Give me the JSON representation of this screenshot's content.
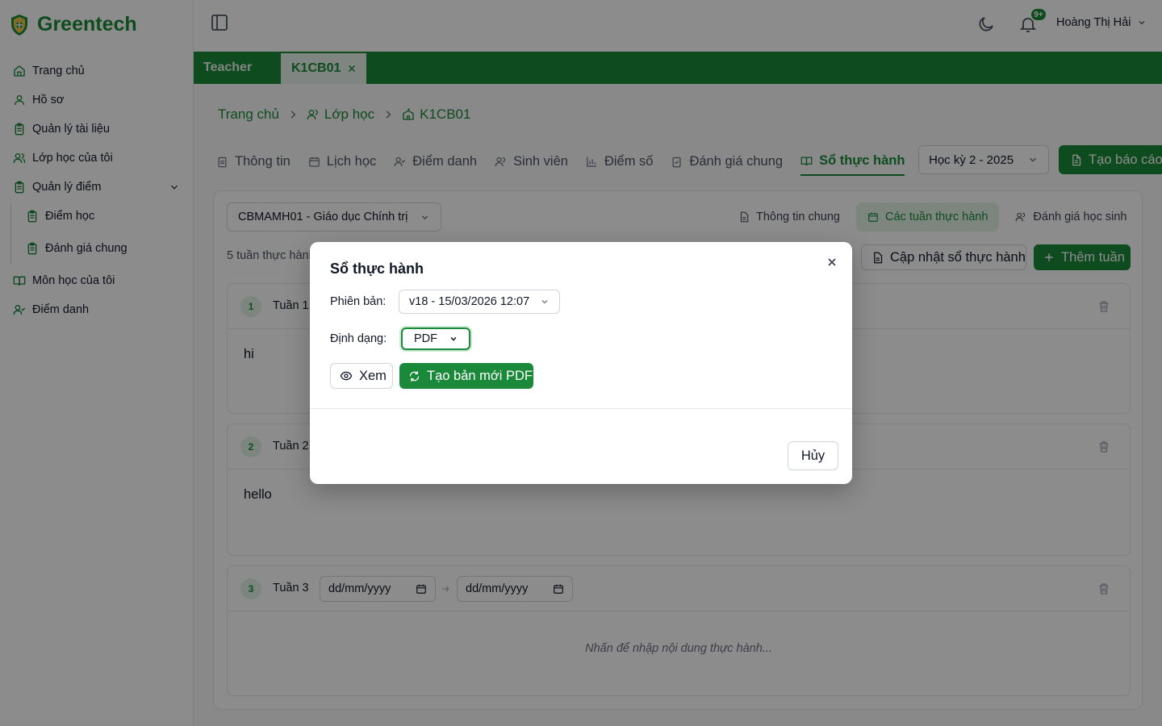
{
  "app": {
    "name": "Greentech",
    "brand_color": "#1a8a3a"
  },
  "sidebar": {
    "items": [
      {
        "label": "Trang chủ",
        "icon": "home-icon"
      },
      {
        "label": "Hồ sơ",
        "icon": "user-icon"
      },
      {
        "label": "Quản lý tài liệu",
        "icon": "clipboard-icon"
      },
      {
        "label": "Lớp học của tôi",
        "icon": "users-icon"
      },
      {
        "label": "Quản lý điểm",
        "icon": "clipboard-icon",
        "expanded": true,
        "children": [
          {
            "label": "Điểm học",
            "icon": "clipboard-icon"
          },
          {
            "label": "Đánh giá chung",
            "icon": "clipboard-icon"
          }
        ]
      },
      {
        "label": "Môn học của tôi",
        "icon": "book-open-icon"
      },
      {
        "label": "Điểm danh",
        "icon": "user-check-icon"
      }
    ]
  },
  "header": {
    "notification_badge": "9+",
    "user_name": "Hoàng Thị Hải"
  },
  "tabbar": {
    "tabs": [
      {
        "label": "Teacher",
        "active": false
      },
      {
        "label": "K1CB01",
        "active": true,
        "closable": true
      }
    ]
  },
  "breadcrumb": {
    "items": [
      "Trang chủ",
      "Lớp học",
      "K1CB01"
    ]
  },
  "class_tabs": {
    "items": [
      "Thông tin",
      "Lịch học",
      "Điểm danh",
      "Sinh viên",
      "Điểm số",
      "Đánh giá chung",
      "Sổ thực hành"
    ],
    "active": "Sổ thực hành",
    "semester": "Học kỳ 2 - 2025",
    "create_report": "Tạo báo cáo"
  },
  "practice": {
    "course": "CBMAMH01 - Giáo dục Chính trị",
    "subtabs": [
      "Thông tin chung",
      "Các tuần thực hành",
      "Đánh giá học sinh"
    ],
    "active_subtab": "Các tuần thực hành",
    "weeks_count": "5 tuần thực hành",
    "update_button": "Cập nhật sổ thực hành",
    "add_week_button": "Thêm tuần",
    "weeks": [
      {
        "number": "1",
        "title": "Tuần 1",
        "content": "hi"
      },
      {
        "number": "2",
        "title": "Tuần 2",
        "content": "hello"
      },
      {
        "number": "3",
        "title": "Tuần 3",
        "date_placeholder": "dd/mm/yyyy",
        "content_placeholder": "Nhấn để nhập nội dung thực hành..."
      }
    ]
  },
  "modal": {
    "title": "Sổ thực hành",
    "version_label": "Phiên bản:",
    "version_value": "v18 - 15/03/2026 12:07",
    "format_label": "Định dạng:",
    "format_value": "PDF",
    "view_button": "Xem",
    "new_button": "Tạo bản mới PDF",
    "cancel_button": "Hủy"
  }
}
